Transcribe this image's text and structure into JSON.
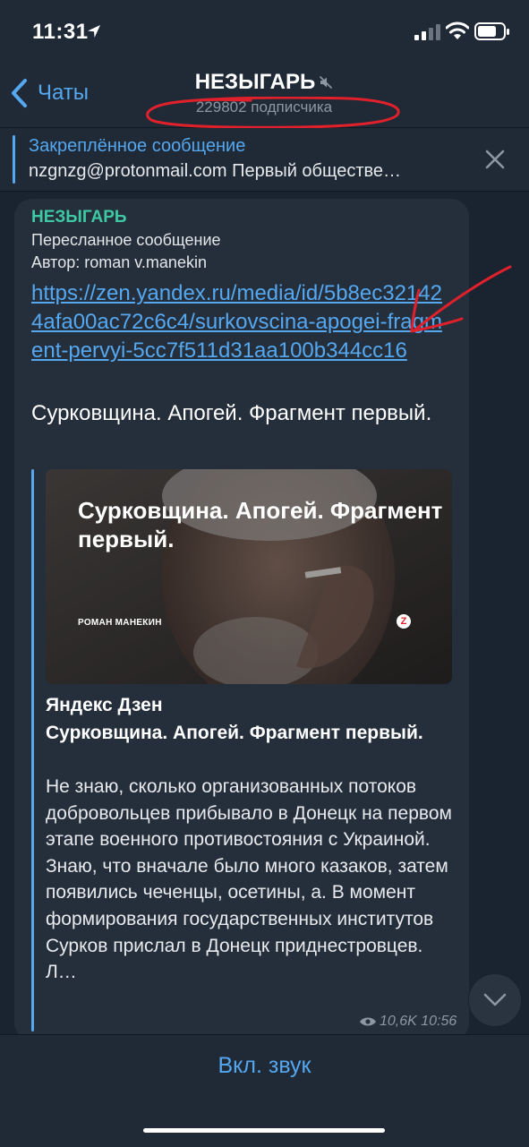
{
  "status": {
    "time": "11:31"
  },
  "nav": {
    "back_label": "Чаты",
    "title": "НЕЗЫГАРЬ",
    "subtitle": "229802 подписчика"
  },
  "pinned": {
    "title": "Закреплённое сообщение",
    "text": "nzgnzg@protonmail.com Первый обществе…"
  },
  "message": {
    "author": "НЕЗЫГАРЬ",
    "forwarded": "Пересланное сообщение",
    "forward_author": "Автор: roman v.manekin",
    "link": "https://zen.yandex.ru/media/id/5b8ec321424afa00ac72c6c4/surkovscina-apogei-fragment-pervyi-5cc7f511d31aa100b344cc16",
    "text": "Сурковщина. Апогей. Фрагмент первый.",
    "preview": {
      "image_title": "Сурковщина. Апогей. Фрагмент первый.",
      "image_author": "РОМАН МАНЕКИН",
      "image_badge": "Z",
      "site": "Яндекс Дзен",
      "title": "Сурковщина. Апогей. Фрагмент первый.",
      "description": "Не знаю, сколько организованных потоков добровольцев прибывало в Донецк на первом этапе военного противостояния с Украиной. Знаю, что вначале было много казаков, затем появились чеченцы, осетины, а. В момент формирования государственных институтов Сурков прислал в Донецк приднестровцев. Л…"
    },
    "views": "10,6K",
    "time": "10:56"
  },
  "bottom": {
    "unmute_label": "Вкл. звук"
  },
  "colors": {
    "background": "#1a2330",
    "bar": "#202a37",
    "bubble": "#252f3c",
    "accent": "#55a8f0",
    "author": "#3ec8a4",
    "annotation": "#e0202a"
  },
  "icons": [
    "location-arrow-icon",
    "signal-icon",
    "wifi-icon",
    "battery-icon",
    "chevron-left-icon",
    "mute-icon",
    "close-icon",
    "eye-icon",
    "chevron-down-icon"
  ]
}
